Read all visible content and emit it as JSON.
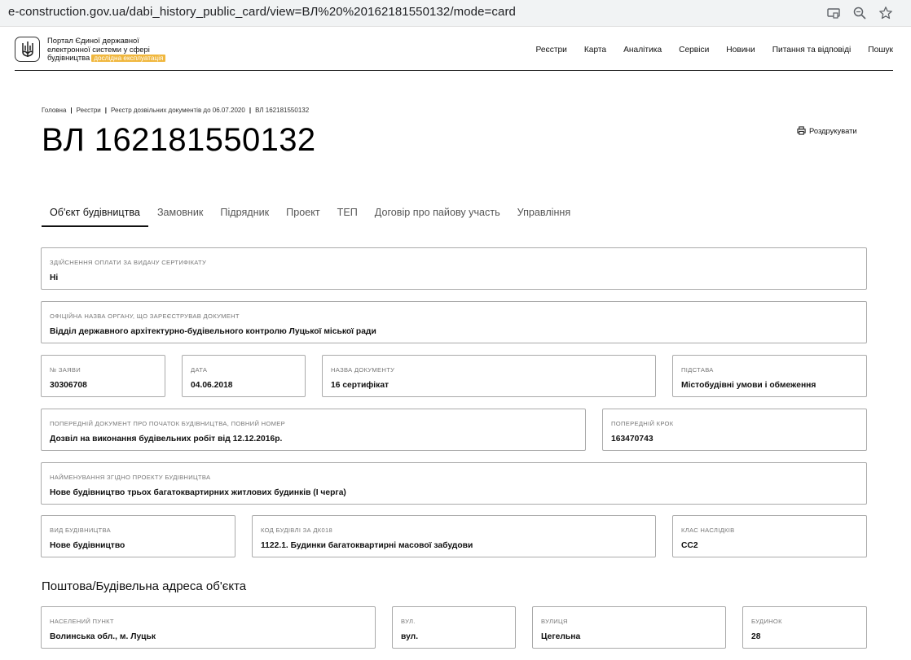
{
  "browser": {
    "url": "e-construction.gov.ua/dabi_history_public_card/view=ВЛ%20%20162181550132/mode=card",
    "icons": [
      "cast-icon",
      "zoom-icon",
      "star-icon"
    ]
  },
  "header": {
    "portal_line1": "Портал Єдиної державної",
    "portal_line2": "електронної системи у сфері",
    "portal_line3": "будівництва",
    "beta": "дослідна експлуатація",
    "nav": [
      "Реєстри",
      "Карта",
      "Аналітика",
      "Сервіси",
      "Новини",
      "Питання та відповіді",
      "Пошук"
    ]
  },
  "breadcrumb": [
    "Головна",
    "Реєстри",
    "Реєстр дозвільних документів до 06.07.2020",
    "ВЛ 162181550132"
  ],
  "title": "ВЛ 162181550132",
  "print_label": "Роздрукувати",
  "tabs": [
    "Об'єкт будівництва",
    "Замовник",
    "Підрядник",
    "Проект",
    "ТЕП",
    "Договір про пайову участь",
    "Управління"
  ],
  "fields": {
    "payment": {
      "label": "Здійснення оплати за видачу сертифікату",
      "value": "Ні"
    },
    "authority": {
      "label": "Офіційна назва органу, що зареєстрував документ",
      "value": "Відділ державного архітектурно-будівельного контролю Луцької міської ради"
    },
    "app_no": {
      "label": "№ заяви",
      "value": "30306708"
    },
    "date": {
      "label": "Дата",
      "value": "04.06.2018"
    },
    "doc_name": {
      "label": "Назва документу",
      "value": "16 сертифікат"
    },
    "basis": {
      "label": "Підстава",
      "value": "Містобудівні умови і обмеження"
    },
    "prev_doc": {
      "label": "Попередній документ про початок будівництва, повний номер",
      "value": "Дозвіл на виконання будівельних робіт від 12.12.2016р."
    },
    "prev_step": {
      "label": "Попередній крок",
      "value": "163470743"
    },
    "project_name": {
      "label": "Найменування згідно проекту будівництва",
      "value": "Нове будівництво трьох багатоквартирних житлових будинків (І черга)"
    },
    "build_type": {
      "label": "Вид будівництва",
      "value": "Нове будівництво"
    },
    "building_code": {
      "label": "Код будівлі за ДК018",
      "value": "1122.1. Будинки багатоквартирні масової забудови"
    },
    "class": {
      "label": "Клас наслідків",
      "value": "СС2"
    },
    "locality": {
      "label": "Населений пункт",
      "value": "Волинська обл., м. Луцьк"
    },
    "street_type": {
      "label": "Вул.",
      "value": "вул."
    },
    "street": {
      "label": "Вулиця",
      "value": "Цегельна"
    },
    "house": {
      "label": "Будинок",
      "value": "28"
    }
  },
  "address_section_title": "Поштова/Будівельна адреса об'єкта"
}
